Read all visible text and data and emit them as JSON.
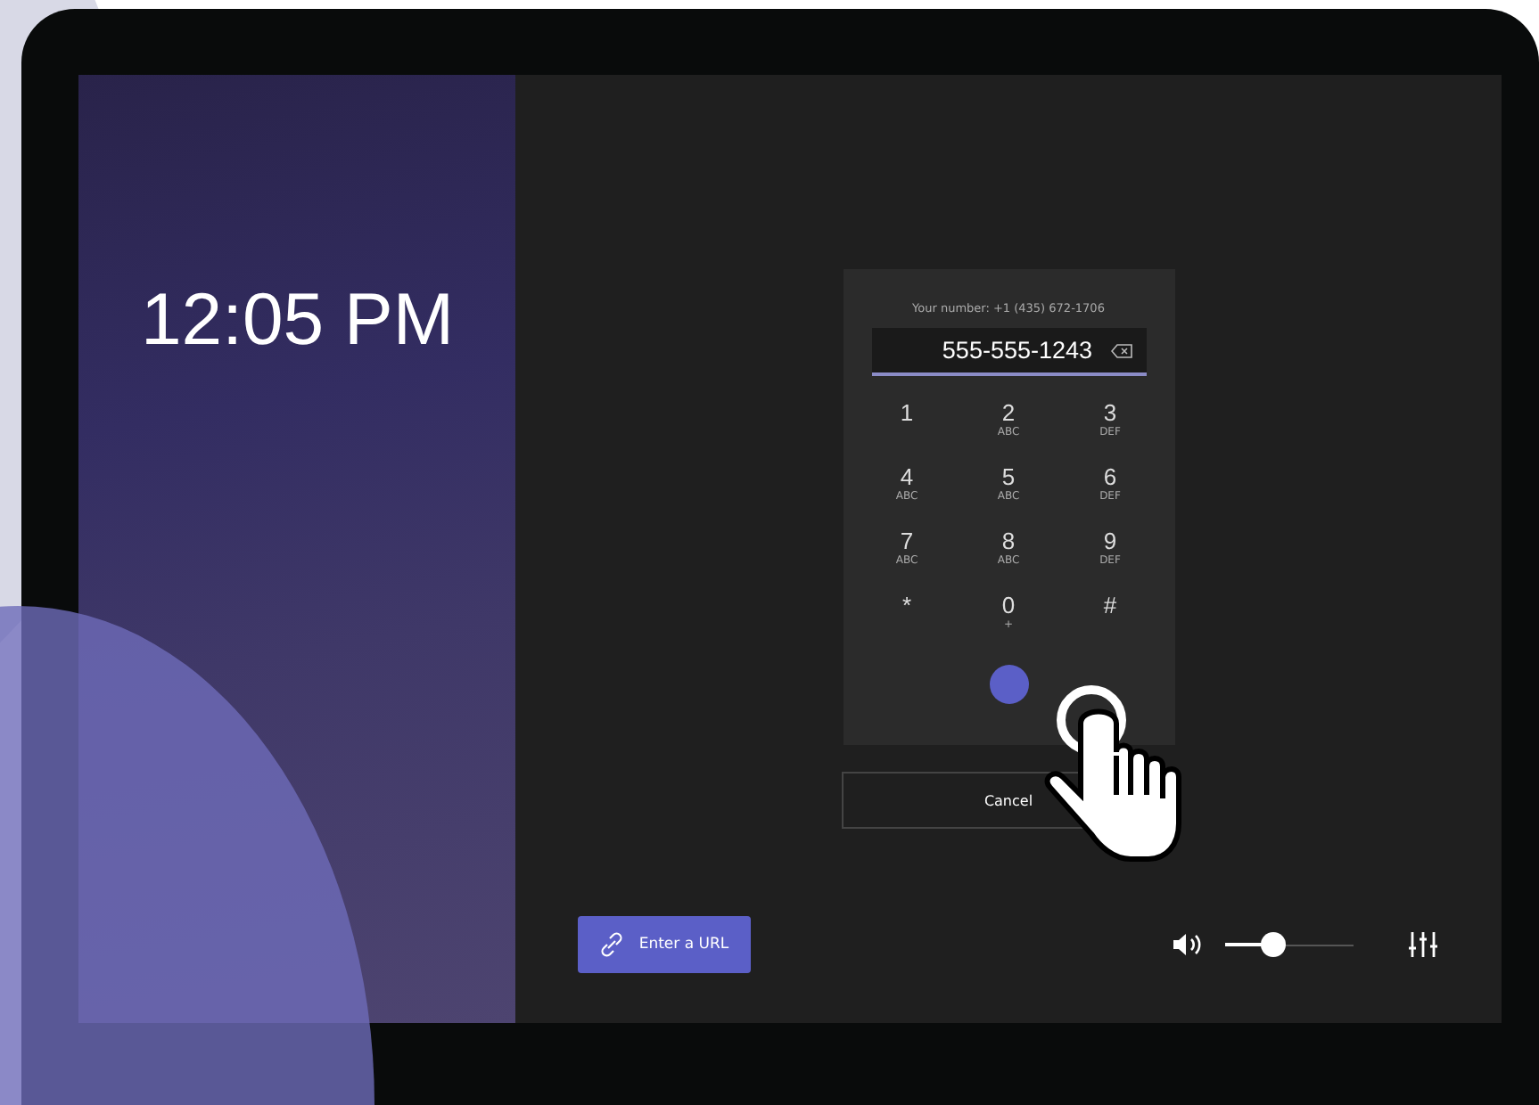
{
  "clock": "12:05 PM",
  "dialpad": {
    "your_number": "Your number: +1 (435) 672-1706",
    "value": "555-555-1243",
    "keys": [
      {
        "digit": "1"
      },
      {
        "digit": "2",
        "letters": "ABC"
      },
      {
        "digit": "3",
        "letters": "DEF"
      },
      {
        "digit": "4",
        "letters": "ABC"
      },
      {
        "digit": "5",
        "letters": "ABC"
      },
      {
        "digit": "6",
        "letters": "DEF"
      },
      {
        "digit": "7",
        "letters": "ABC"
      },
      {
        "digit": "8",
        "letters": "ABC"
      },
      {
        "digit": "9",
        "letters": "DEF"
      },
      {
        "digit": "*"
      },
      {
        "digit": "0",
        "letters": "+"
      },
      {
        "digit": "#"
      }
    ]
  },
  "cancel_button": "Cancel",
  "url_button": "Enter a URL",
  "volume": {
    "level": 0.38
  }
}
